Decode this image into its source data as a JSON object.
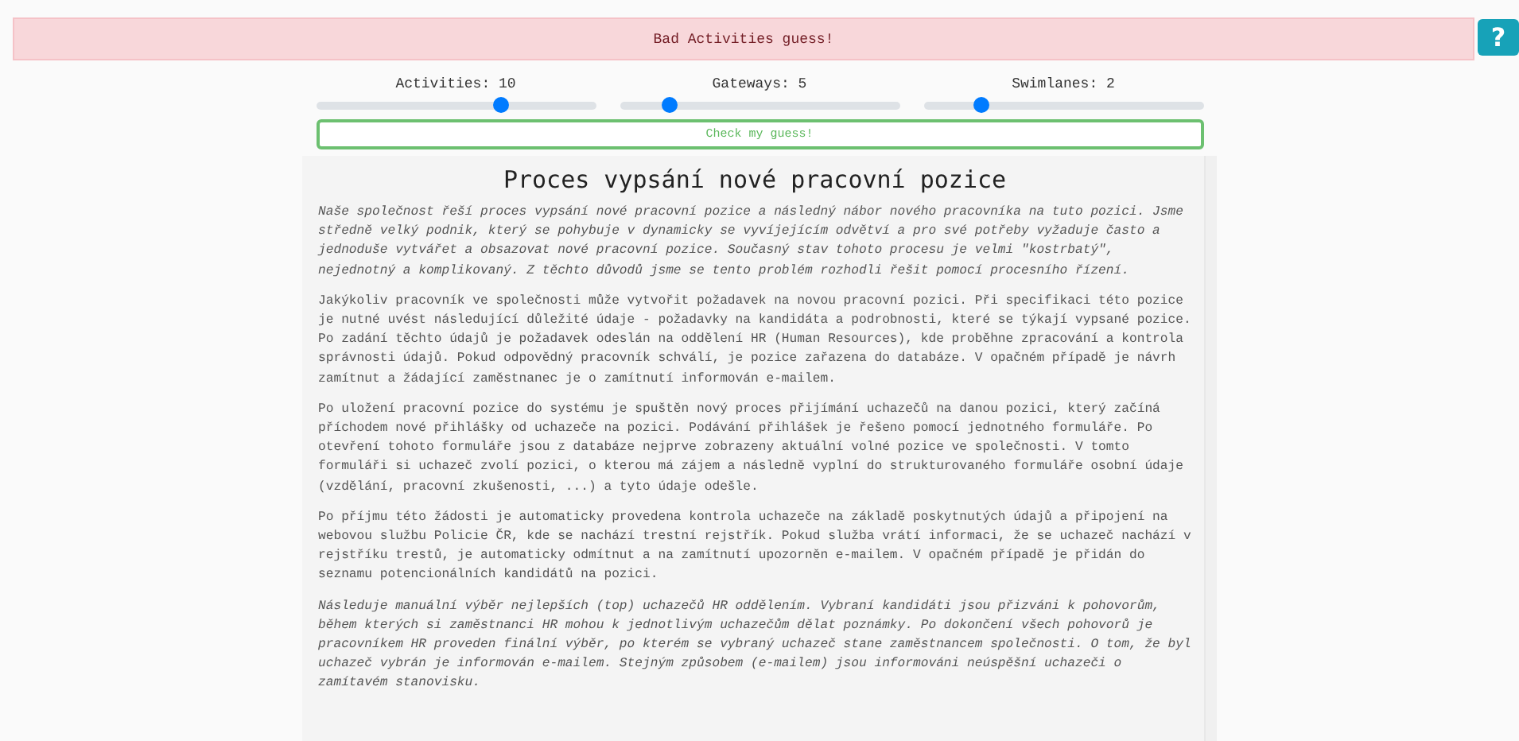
{
  "banner": {
    "text": "Bad Activities guess!",
    "kind": "error"
  },
  "help_button": {
    "label": "?"
  },
  "sliders": [
    {
      "label": "Activities: 10",
      "level": 0.66
    },
    {
      "label": "Gateways: 5",
      "level": 0.18
    },
    {
      "label": "Swimlanes: 2",
      "level": 0.21
    }
  ],
  "check_button": {
    "label": "Check my guess!"
  },
  "document": {
    "title": "Proces vypsání nové pracovní pozice",
    "paragraphs": [
      {
        "kind": "italic",
        "text": "Naše společnost řeší proces vypsání nové pracovní pozice a následný nábor nového pracovníka na tuto pozici. Jsme středně velký podnik, který se pohybuje v dynamicky se vyvíjejícím odvětví a pro své potřeby vyžaduje často a jednoduše vytvářet a obsazovat nové pracovní pozice. Současný stav tohoto procesu je velmi \"kostrbatý\", nejednotný a komplikovaný. Z těchto důvodů jsme se tento problém rozhodli řešit pomocí procesního řízení."
      },
      {
        "kind": "plain",
        "text": "Jakýkoliv pracovník ve společnosti může vytvořit požadavek na novou pracovní pozici. Při specifikaci této pozice je nutné uvést následující důležité údaje - požadavky na kandidáta a podrobnosti, které se týkají vypsané pozice. Po zadání těchto údajů je požadavek odeslán na oddělení HR (Human Resources), kde proběhne zpracování a kontrola správnosti údajů. Pokud odpovědný pracovník schválí, je pozice zařazena do databáze. V opačném případě je návrh zamítnut a žádající zaměstnanec je o zamítnutí informován e-mailem."
      },
      {
        "kind": "plain",
        "text": "Po uložení pracovní pozice do systému je spuštěn nový proces přijímání uchazečů na danou pozici, který začíná příchodem nové přihlášky od uchazeče na pozici. Podávání přihlášek je řešeno pomocí jednotného formuláře. Po otevření tohoto formuláře jsou z databáze nejprve zobrazeny aktuální volné pozice ve společnosti. V tomto formuláři si uchazeč zvolí pozici, o kterou má zájem a následně vyplní do strukturovaného formuláře osobní údaje (vzdělání, pracovní zkušenosti, ...) a tyto údaje odešle."
      },
      {
        "kind": "plain",
        "text": "Po příjmu této žádosti je automaticky provedena kontrola uchazeče na základě poskytnutých údajů a připojení na webovou službu Policie ČR, kde se nachází trestní rejstřík. Pokud služba vrátí informaci, že se uchazeč nachází v rejstříku trestů, je automaticky odmítnut a na zamítnutí upozorněn e-mailem. V opačném případě je přidán do seznamu potencionálních kandidátů na pozici."
      },
      {
        "kind": "italic",
        "text": "Následuje manuální výběr nejlepších (top) uchazečů HR oddělením. Vybraní kandidáti jsou přizváni k pohovorům, během kterých si zaměstnanci HR mohou k jednotlivým uchazečům dělat poznámky. Po dokončení všech pohovorů je pracovníkem HR proveden finální výběr, po kterém se vybraný uchazeč stane zaměstnancem společnosti. O tom, že byl uchazeč vybrán je informován e-mailem. Stejným způsobem (e-mailem) jsou informováni neúspěšní uchazeči o zamítavém stanovisku."
      }
    ]
  }
}
